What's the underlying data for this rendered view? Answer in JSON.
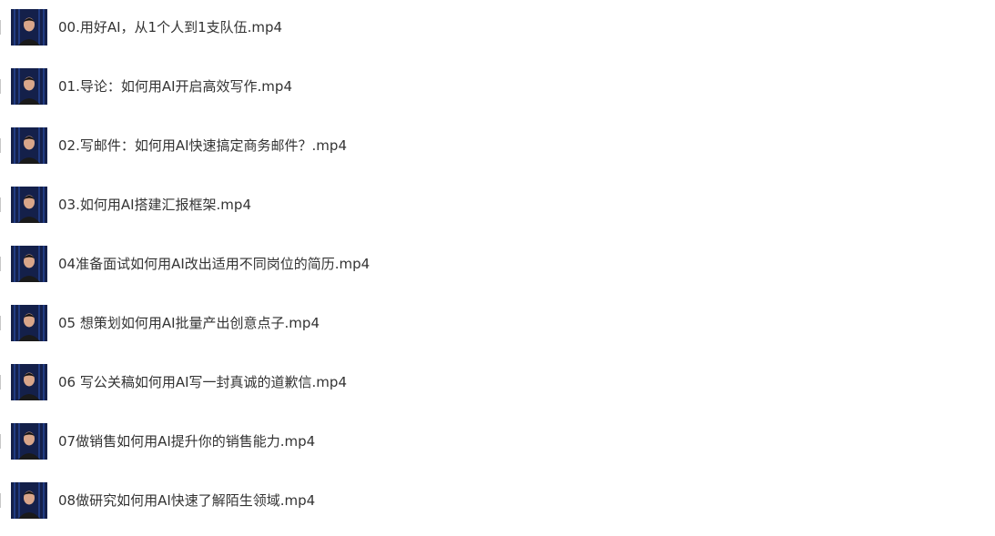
{
  "files": [
    {
      "name": "00.用好AI，从1个人到1支队伍.mp4",
      "thumbnail_icon": "video-thumbnail-icon"
    },
    {
      "name": "01.导论：如何用AI开启高效写作.mp4",
      "thumbnail_icon": "video-thumbnail-icon"
    },
    {
      "name": "02.写邮件：如何用AI快速搞定商务邮件？.mp4",
      "thumbnail_icon": "video-thumbnail-icon"
    },
    {
      "name": "03.如何用AI搭建汇报框架.mp4",
      "thumbnail_icon": "video-thumbnail-icon"
    },
    {
      "name": "04准备面试如何用AI改出适用不同岗位的简历.mp4",
      "thumbnail_icon": "video-thumbnail-icon"
    },
    {
      "name": "05 想策划如何用AI批量产出创意点子.mp4",
      "thumbnail_icon": "video-thumbnail-icon"
    },
    {
      "name": "06 写公关稿如何用AI写一封真诚的道歉信.mp4",
      "thumbnail_icon": "video-thumbnail-icon"
    },
    {
      "name": "07做销售如何用AI提升你的销售能力.mp4",
      "thumbnail_icon": "video-thumbnail-icon"
    },
    {
      "name": "08做研究如何用AI快速了解陌生领域.mp4",
      "thumbnail_icon": "video-thumbnail-icon"
    }
  ],
  "colors": {
    "text": "#333333",
    "thumb_background": "#14204a",
    "thumb_curtain": "#1f3a8a",
    "speaker_shirt": "#1a1a1a",
    "speaker_skin": "#d9a68a"
  }
}
